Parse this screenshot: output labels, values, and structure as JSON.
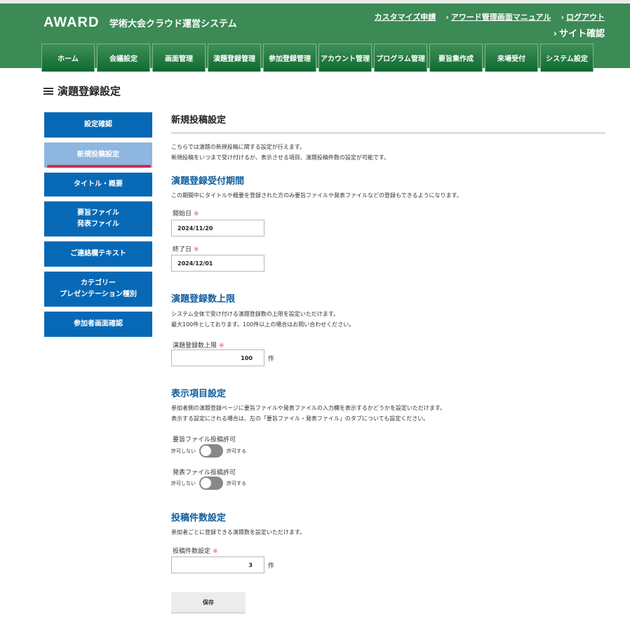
{
  "header": {
    "logo": "AWARD",
    "system_name": "学術大会クラウド運営システム",
    "links": [
      "カスタマイズ申請",
      "アワード管理画面マニュアル",
      "ログアウト"
    ],
    "site_confirm": "サイト確認"
  },
  "nav": {
    "tabs": [
      "ホーム",
      "会議設定",
      "画面管理",
      "演題登録管理",
      "参加登録管理",
      "アカウント管理",
      "プログラム管理",
      "要旨集作成",
      "来場受付",
      "システム設定"
    ]
  },
  "page_title": "演題登録設定",
  "sidebar": {
    "items": [
      {
        "label": "設定確認"
      },
      {
        "label": "新規投稿設定",
        "active": true
      },
      {
        "label": "タイトル・概要"
      },
      {
        "line1": "要旨ファイル",
        "line2": "発表ファイル"
      },
      {
        "label": "ご連絡欄テキスト"
      },
      {
        "line1": "カテゴリー",
        "line2": "プレゼンテーション種別"
      },
      {
        "label": "参加者画面確認"
      }
    ]
  },
  "main": {
    "title": "新規投稿設定",
    "intro": [
      "こちらでは演題の新規投稿に関する設定が行えます。",
      "新規投稿をいつまで受け付けるか、表示させる項目、演題投稿件数の設定が可能です。"
    ],
    "period": {
      "heading": "演題登録受付期間",
      "desc": "この期間中にタイトルや概要を登録された方のみ要旨ファイルや発表ファイルなどの登録もできるようになります。",
      "start_label": "開始日",
      "start_value": "2024/11/20",
      "end_label": "終了日",
      "end_value": "2024/12/01",
      "required_mark": "※"
    },
    "limit": {
      "heading": "演題登録数上限",
      "desc1": "システム全体で受け付ける演題登録数の上限を設定いただけます。",
      "desc2": "最大100件としております。100件以上の場合はお問い合わせください。",
      "label": "演題登録数上限",
      "value": "100",
      "unit": "件",
      "required_mark": "※"
    },
    "display": {
      "heading": "表示項目設定",
      "desc1": "参加者側の演題登録ページに要旨ファイルや発表ファイルの入力欄を表示するかどうかを設定いただけます。",
      "desc2": "表示する設定にされる場合は、左の「要旨ファイル・発表ファイル」のタブについても設定ください。",
      "summary_label": "要旨ファイル投稿許可",
      "presentation_label": "発表ファイル投稿許可",
      "off_label": "許可しない",
      "on_label": "許可する"
    },
    "count": {
      "heading": "投稿件数設定",
      "desc": "参加者ごとに登録できる演題数を設定いただけます。",
      "label": "投稿件数設定",
      "value": "3",
      "unit": "件",
      "required_mark": "※"
    },
    "save_label": "保存"
  }
}
